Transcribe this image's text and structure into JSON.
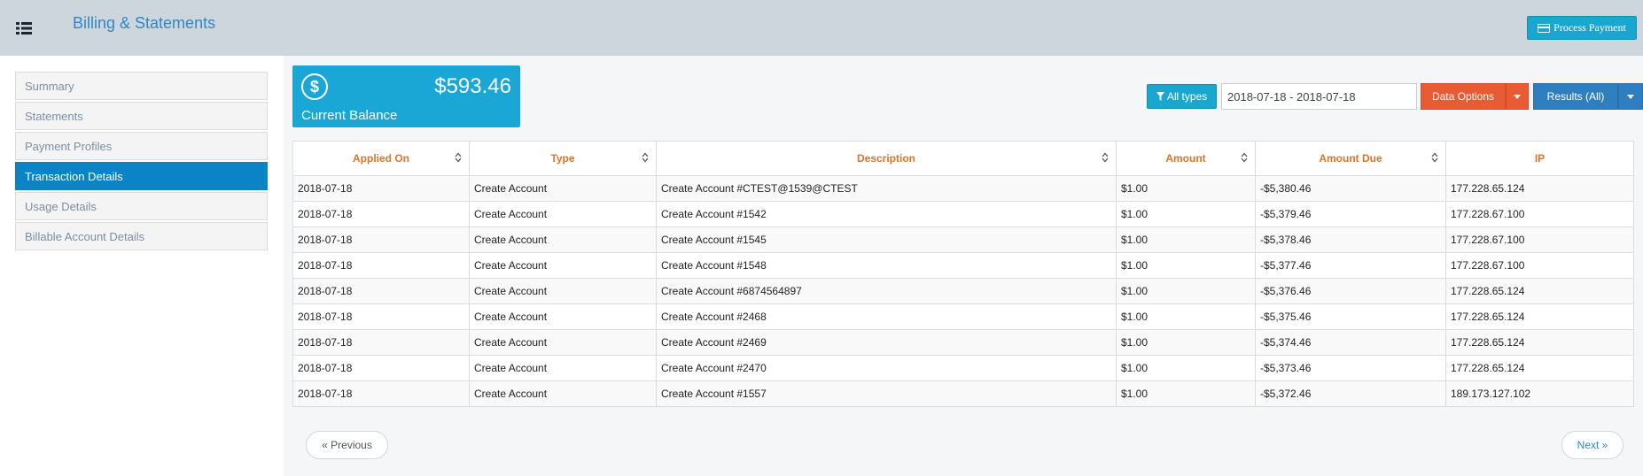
{
  "header": {
    "title": "Billing & Statements",
    "menu_icon": "list-icon",
    "process_payment_label": "Process Payment",
    "process_payment_icon": "credit-card-icon"
  },
  "sidebar": {
    "items": [
      {
        "label": "Summary",
        "active": false
      },
      {
        "label": "Statements",
        "active": false
      },
      {
        "label": "Payment Profiles",
        "active": false
      },
      {
        "label": "Transaction Details",
        "active": true
      },
      {
        "label": "Usage Details",
        "active": false
      },
      {
        "label": "Billable Account Details",
        "active": false
      }
    ]
  },
  "balance": {
    "amount": "$593.46",
    "label": "Current Balance",
    "icon": "dollar-circle-icon"
  },
  "filters": {
    "all_types_label": "All types",
    "all_types_icon": "filter-icon",
    "date_range": "2018-07-18 - 2018-07-18",
    "data_options_label": "Data Options",
    "results_label": "Results (All)"
  },
  "table": {
    "columns": [
      "Applied On",
      "Type",
      "Description",
      "Amount",
      "Amount Due",
      "IP"
    ],
    "rows": [
      [
        "2018-07-18",
        "Create Account",
        "Create Account #CTEST@1539@CTEST",
        "$1.00",
        "-$5,380.46",
        "177.228.65.124"
      ],
      [
        "2018-07-18",
        "Create Account",
        "Create Account #1542",
        "$1.00",
        "-$5,379.46",
        "177.228.67.100"
      ],
      [
        "2018-07-18",
        "Create Account",
        "Create Account #1545",
        "$1.00",
        "-$5,378.46",
        "177.228.67.100"
      ],
      [
        "2018-07-18",
        "Create Account",
        "Create Account #1548",
        "$1.00",
        "-$5,377.46",
        "177.228.67.100"
      ],
      [
        "2018-07-18",
        "Create Account",
        "Create Account #6874564897",
        "$1.00",
        "-$5,376.46",
        "177.228.65.124"
      ],
      [
        "2018-07-18",
        "Create Account",
        "Create Account #2468",
        "$1.00",
        "-$5,375.46",
        "177.228.65.124"
      ],
      [
        "2018-07-18",
        "Create Account",
        "Create Account #2469",
        "$1.00",
        "-$5,374.46",
        "177.228.65.124"
      ],
      [
        "2018-07-18",
        "Create Account",
        "Create Account #2470",
        "$1.00",
        "-$5,373.46",
        "177.228.65.124"
      ],
      [
        "2018-07-18",
        "Create Account",
        "Create Account #1557",
        "$1.00",
        "-$5,372.46",
        "189.173.127.102"
      ]
    ]
  },
  "pagination": {
    "previous_label": "« Previous",
    "next_label": "Next »"
  },
  "colors": {
    "accent_cyan": "#1aa7cf",
    "active_blue": "#0a84c6",
    "header_orange": "#de7428",
    "data_options_orange": "#e95b33"
  }
}
